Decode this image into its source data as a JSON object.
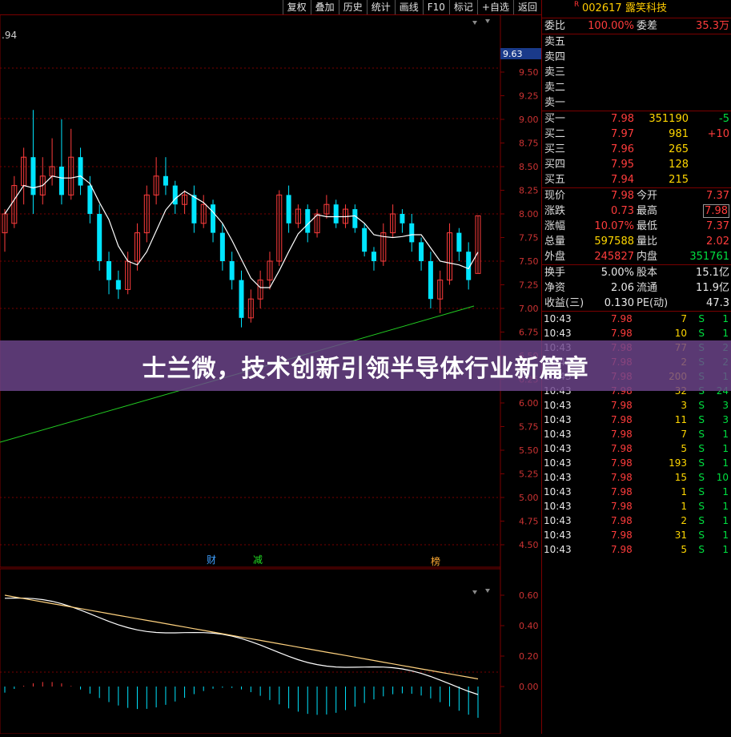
{
  "toolbar": {
    "buttons": [
      "复权",
      "叠加",
      "历史",
      "统计",
      "画线",
      "F10",
      "标记",
      "+自选",
      "返回"
    ]
  },
  "chart": {
    "corner_label": ".94",
    "price_ticks": [
      "9.50",
      "9.25",
      "9.00",
      "8.75",
      "8.50",
      "8.25",
      "8.00",
      "7.75",
      "7.50",
      "7.25",
      "7.00",
      "6.75",
      "6.50",
      "6.25",
      "6.00",
      "5.75",
      "5.50",
      "5.25",
      "5.00",
      "4.75",
      "4.50"
    ],
    "price_tag": "9.63",
    "markers": [
      "财",
      "减",
      "榜"
    ],
    "sub_ticks": [
      "0.60",
      "0.40",
      "0.20",
      "0.00"
    ]
  },
  "stock": {
    "r_mark": "R",
    "code": "002617",
    "name": "露笑科技"
  },
  "quote": {
    "webi_label": "委比",
    "webi": "100.00%",
    "weicha_label": "委差",
    "weicha": "35.3万",
    "sells": [
      "卖五",
      "卖四",
      "卖三",
      "卖二",
      "卖一"
    ],
    "buys": [
      {
        "label": "买一",
        "price": "7.98",
        "vol": "351190",
        "chg": "-5"
      },
      {
        "label": "买二",
        "price": "7.97",
        "vol": "981",
        "chg": "+10"
      },
      {
        "label": "买三",
        "price": "7.96",
        "vol": "265",
        "chg": ""
      },
      {
        "label": "买四",
        "price": "7.95",
        "vol": "128",
        "chg": ""
      },
      {
        "label": "买五",
        "price": "7.94",
        "vol": "215",
        "chg": ""
      }
    ],
    "stats": [
      {
        "l1": "现价",
        "v1": "7.98",
        "c1": "red",
        "l2": "今开",
        "v2": "7.37",
        "c2": "red"
      },
      {
        "l1": "涨跌",
        "v1": "0.73",
        "c1": "red",
        "l2": "最高",
        "v2": "7.98",
        "c2": "red"
      },
      {
        "l1": "涨幅",
        "v1": "10.07%",
        "c1": "red",
        "l2": "最低",
        "v2": "7.37",
        "c2": "red"
      },
      {
        "l1": "总量",
        "v1": "597588",
        "c1": "yellow",
        "l2": "量比",
        "v2": "2.02",
        "c2": "red"
      },
      {
        "l1": "外盘",
        "v1": "245827",
        "c1": "red",
        "l2": "内盘",
        "v2": "351761",
        "c2": "green"
      }
    ],
    "fund": [
      {
        "l1": "换手",
        "v1": "5.00%",
        "l2": "股本",
        "v2": "15.1亿"
      },
      {
        "l1": "净资",
        "v1": "2.06",
        "l2": "流通",
        "v2": "11.9亿"
      },
      {
        "l1": "收益(三)",
        "v1": "0.130",
        "l2": "PE(动)",
        "v2": "47.3"
      }
    ]
  },
  "trades": [
    {
      "time": "10:43",
      "price": "7.98",
      "vol": "7",
      "side": "S",
      "n": "1"
    },
    {
      "time": "10:43",
      "price": "7.98",
      "vol": "10",
      "side": "S",
      "n": "1"
    },
    {
      "time": "10:43",
      "price": "7.98",
      "vol": "77",
      "side": "S",
      "n": "2"
    },
    {
      "time": "10:43",
      "price": "7.98",
      "vol": "2",
      "side": "S",
      "n": "2"
    },
    {
      "time": "10:43",
      "price": "7.98",
      "vol": "200",
      "side": "S",
      "n": "1"
    },
    {
      "time": "10:43",
      "price": "7.98",
      "vol": "32",
      "side": "S",
      "n": "24"
    },
    {
      "time": "10:43",
      "price": "7.98",
      "vol": "3",
      "side": "S",
      "n": "3"
    },
    {
      "time": "10:43",
      "price": "7.98",
      "vol": "11",
      "side": "S",
      "n": "3"
    },
    {
      "time": "10:43",
      "price": "7.98",
      "vol": "7",
      "side": "S",
      "n": "1"
    },
    {
      "time": "10:43",
      "price": "7.98",
      "vol": "5",
      "side": "S",
      "n": "1"
    },
    {
      "time": "10:43",
      "price": "7.98",
      "vol": "193",
      "side": "S",
      "n": "1"
    },
    {
      "time": "10:43",
      "price": "7.98",
      "vol": "15",
      "side": "S",
      "n": "10"
    },
    {
      "time": "10:43",
      "price": "7.98",
      "vol": "1",
      "side": "S",
      "n": "1"
    },
    {
      "time": "10:43",
      "price": "7.98",
      "vol": "1",
      "side": "S",
      "n": "1"
    },
    {
      "time": "10:43",
      "price": "7.98",
      "vol": "2",
      "side": "S",
      "n": "1"
    },
    {
      "time": "10:43",
      "price": "7.98",
      "vol": "31",
      "side": "S",
      "n": "1"
    },
    {
      "time": "10:43",
      "price": "7.98",
      "vol": "5",
      "side": "S",
      "n": "1"
    }
  ],
  "banner": {
    "headline": "士兰微，技术创新引领半导体行业新篇章"
  },
  "colors": {
    "up": "#ff3c3c",
    "down": "#00e5ff",
    "ma": "#ffffff",
    "trend": "#22cc22",
    "border": "#7a0000",
    "banner": "#6e468c"
  }
}
